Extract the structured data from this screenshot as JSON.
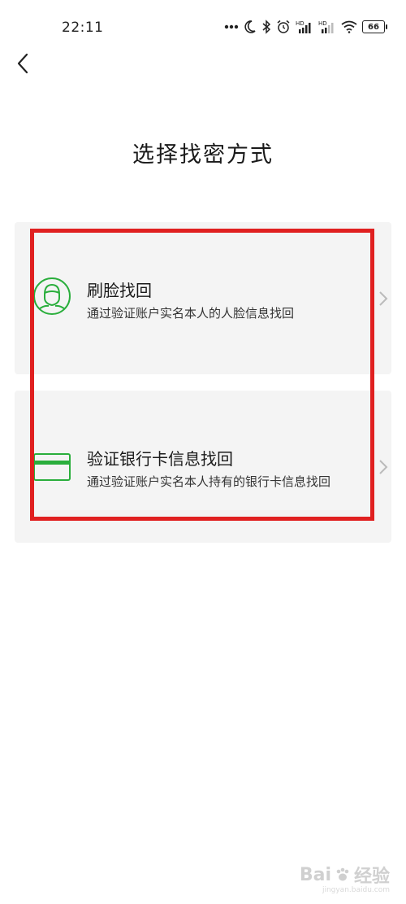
{
  "status_bar": {
    "time": "22:11",
    "battery": "66",
    "icons": [
      "more-dots-icon",
      "moon-icon",
      "bluetooth-icon",
      "alarm-icon",
      "hd-signal-icon",
      "hd-signal-icon",
      "wifi-icon",
      "battery-icon"
    ]
  },
  "header": {
    "back_icon": "chevron-left-icon",
    "title": "选择找密方式"
  },
  "options": [
    {
      "icon": "face-icon",
      "title": "刷脸找回",
      "description": "通过验证账户实名本人的人脸信息找回"
    },
    {
      "icon": "bank-card-icon",
      "title": "验证银行卡信息找回",
      "description": "通过验证账户实名本人持有的银行卡信息找回"
    }
  ],
  "colors": {
    "accent_green": "#2aae3c",
    "annotation_red": "#e02020",
    "card_bg": "#f4f4f4"
  },
  "watermark": {
    "logo_text": "Bai",
    "logo_suffix": "经验",
    "sub": "jingyan.baidu.com"
  }
}
